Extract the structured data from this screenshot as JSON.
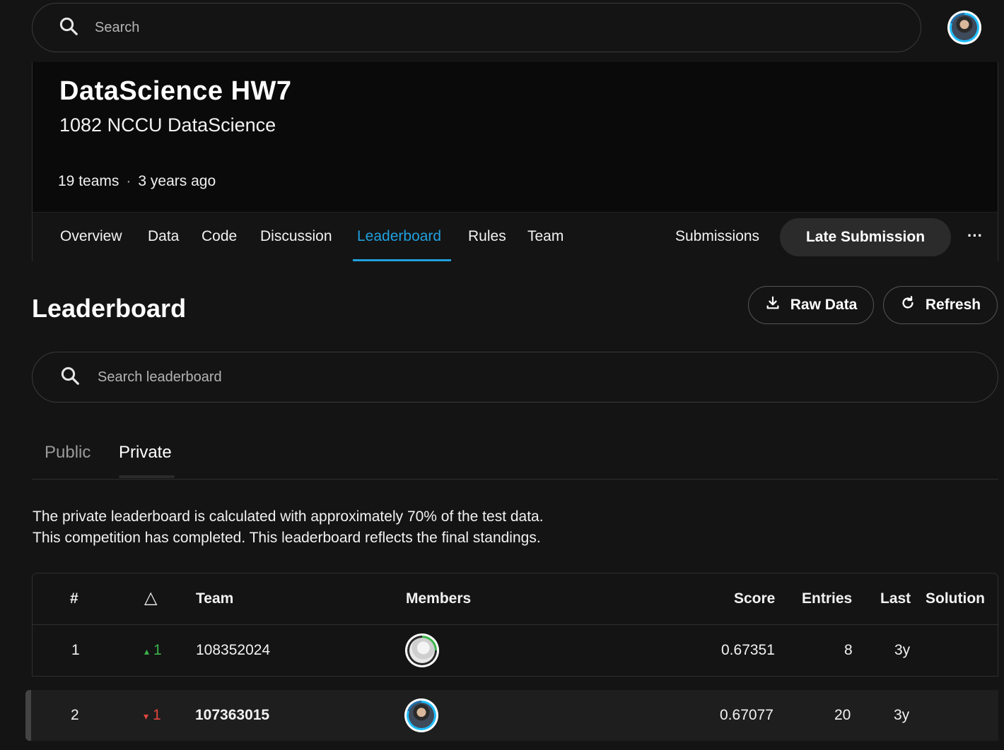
{
  "topbar": {
    "search_placeholder": "Search"
  },
  "competition": {
    "title": "DataScience HW7",
    "subtitle": "1082 NCCU DataScience",
    "teams": "19 teams",
    "age": "3 years ago"
  },
  "nav": {
    "tabs": [
      "Overview",
      "Data",
      "Code",
      "Discussion",
      "Leaderboard",
      "Rules",
      "Team"
    ],
    "active": "Leaderboard",
    "submissions": "Submissions",
    "late_submission": "Late Submission",
    "more": "···"
  },
  "leaderboard": {
    "title": "Leaderboard",
    "raw_data": "Raw Data",
    "refresh": "Refresh",
    "search_placeholder": "Search leaderboard",
    "tabs": [
      "Public",
      "Private"
    ],
    "active_tab": "Private",
    "info_line1": "The private leaderboard is calculated with approximately 70% of the test data.",
    "info_line2": "This competition has completed. This leaderboard reflects the final standings.",
    "columns": {
      "rank": "#",
      "change": "△",
      "team": "Team",
      "members": "Members",
      "score": "Score",
      "entries": "Entries",
      "last": "Last",
      "solution": "Solution"
    },
    "rows": [
      {
        "rank": "1",
        "change_dir": "up",
        "change_arrow": "▴",
        "change": "1",
        "team": "108352024",
        "member_icon": "goose-avatar-icon",
        "score": "0.67351",
        "entries": "8",
        "last": "3y"
      },
      {
        "rank": "2",
        "change_dir": "down",
        "change_arrow": "▾",
        "change": "1",
        "team": "107363015",
        "member_icon": "user-avatar-icon",
        "score": "0.67077",
        "entries": "20",
        "last": "3y"
      }
    ]
  },
  "colors": {
    "accent": "#20a0dd",
    "up": "#3bb44a",
    "down": "#e2463d",
    "background": "#141414"
  }
}
